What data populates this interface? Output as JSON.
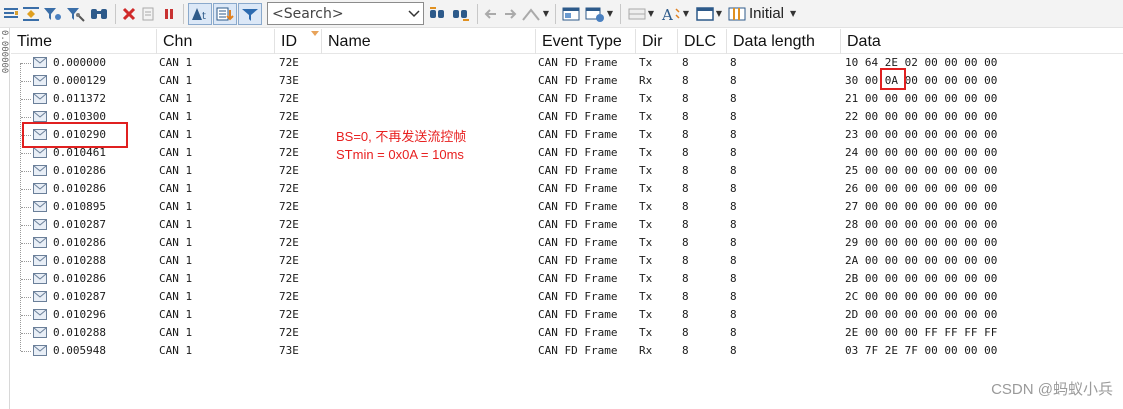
{
  "toolbar": {
    "search_placeholder": "<Search>",
    "initial_label": "Initial"
  },
  "left_strip_text": "0.000000",
  "columns": [
    "Time",
    "Chn",
    "ID",
    "Name",
    "Event Type",
    "Dir",
    "DLC",
    "Data length",
    "Data"
  ],
  "rows": [
    {
      "time": "0.000000",
      "chn": "CAN 1",
      "id": "72E",
      "name": "",
      "event": "CAN FD Frame",
      "dir": "Tx",
      "dlc": "8",
      "len": "8",
      "data": "10 64 2E 02 00 00 00 00"
    },
    {
      "time": "0.000129",
      "chn": "CAN 1",
      "id": "73E",
      "name": "",
      "event": "CAN FD Frame",
      "dir": "Rx",
      "dlc": "8",
      "len": "8",
      "data": "30 00 0A 00 00 00 00 00"
    },
    {
      "time": "0.011372",
      "chn": "CAN 1",
      "id": "72E",
      "name": "",
      "event": "CAN FD Frame",
      "dir": "Tx",
      "dlc": "8",
      "len": "8",
      "data": "21 00 00 00 00 00 00 00"
    },
    {
      "time": "0.010300",
      "chn": "CAN 1",
      "id": "72E",
      "name": "",
      "event": "CAN FD Frame",
      "dir": "Tx",
      "dlc": "8",
      "len": "8",
      "data": "22 00 00 00 00 00 00 00"
    },
    {
      "time": "0.010290",
      "chn": "CAN 1",
      "id": "72E",
      "name": "",
      "event": "CAN FD Frame",
      "dir": "Tx",
      "dlc": "8",
      "len": "8",
      "data": "23 00 00 00 00 00 00 00"
    },
    {
      "time": "0.010461",
      "chn": "CAN 1",
      "id": "72E",
      "name": "",
      "event": "CAN FD Frame",
      "dir": "Tx",
      "dlc": "8",
      "len": "8",
      "data": "24 00 00 00 00 00 00 00"
    },
    {
      "time": "0.010286",
      "chn": "CAN 1",
      "id": "72E",
      "name": "",
      "event": "CAN FD Frame",
      "dir": "Tx",
      "dlc": "8",
      "len": "8",
      "data": "25 00 00 00 00 00 00 00"
    },
    {
      "time": "0.010286",
      "chn": "CAN 1",
      "id": "72E",
      "name": "",
      "event": "CAN FD Frame",
      "dir": "Tx",
      "dlc": "8",
      "len": "8",
      "data": "26 00 00 00 00 00 00 00"
    },
    {
      "time": "0.010895",
      "chn": "CAN 1",
      "id": "72E",
      "name": "",
      "event": "CAN FD Frame",
      "dir": "Tx",
      "dlc": "8",
      "len": "8",
      "data": "27 00 00 00 00 00 00 00"
    },
    {
      "time": "0.010287",
      "chn": "CAN 1",
      "id": "72E",
      "name": "",
      "event": "CAN FD Frame",
      "dir": "Tx",
      "dlc": "8",
      "len": "8",
      "data": "28 00 00 00 00 00 00 00"
    },
    {
      "time": "0.010286",
      "chn": "CAN 1",
      "id": "72E",
      "name": "",
      "event": "CAN FD Frame",
      "dir": "Tx",
      "dlc": "8",
      "len": "8",
      "data": "29 00 00 00 00 00 00 00"
    },
    {
      "time": "0.010288",
      "chn": "CAN 1",
      "id": "72E",
      "name": "",
      "event": "CAN FD Frame",
      "dir": "Tx",
      "dlc": "8",
      "len": "8",
      "data": "2A 00 00 00 00 00 00 00"
    },
    {
      "time": "0.010286",
      "chn": "CAN 1",
      "id": "72E",
      "name": "",
      "event": "CAN FD Frame",
      "dir": "Tx",
      "dlc": "8",
      "len": "8",
      "data": "2B 00 00 00 00 00 00 00"
    },
    {
      "time": "0.010287",
      "chn": "CAN 1",
      "id": "72E",
      "name": "",
      "event": "CAN FD Frame",
      "dir": "Tx",
      "dlc": "8",
      "len": "8",
      "data": "2C 00 00 00 00 00 00 00"
    },
    {
      "time": "0.010296",
      "chn": "CAN 1",
      "id": "72E",
      "name": "",
      "event": "CAN FD Frame",
      "dir": "Tx",
      "dlc": "8",
      "len": "8",
      "data": "2D 00 00 00 00 00 00 00"
    },
    {
      "time": "0.010288",
      "chn": "CAN 1",
      "id": "72E",
      "name": "",
      "event": "CAN FD Frame",
      "dir": "Tx",
      "dlc": "8",
      "len": "8",
      "data": "2E 00 00 00 FF FF FF FF"
    },
    {
      "time": "0.005948",
      "chn": "CAN 1",
      "id": "73E",
      "name": "",
      "event": "CAN FD Frame",
      "dir": "Rx",
      "dlc": "8",
      "len": "8",
      "data": "03 7F 2E 7F 00 00 00 00"
    }
  ],
  "annotations": {
    "line1": "BS=0, 不再发送流控帧",
    "line2": "STmin = 0x0A = 10ms",
    "color": "#e02020"
  },
  "watermark": "CSDN @蚂蚁小兵"
}
